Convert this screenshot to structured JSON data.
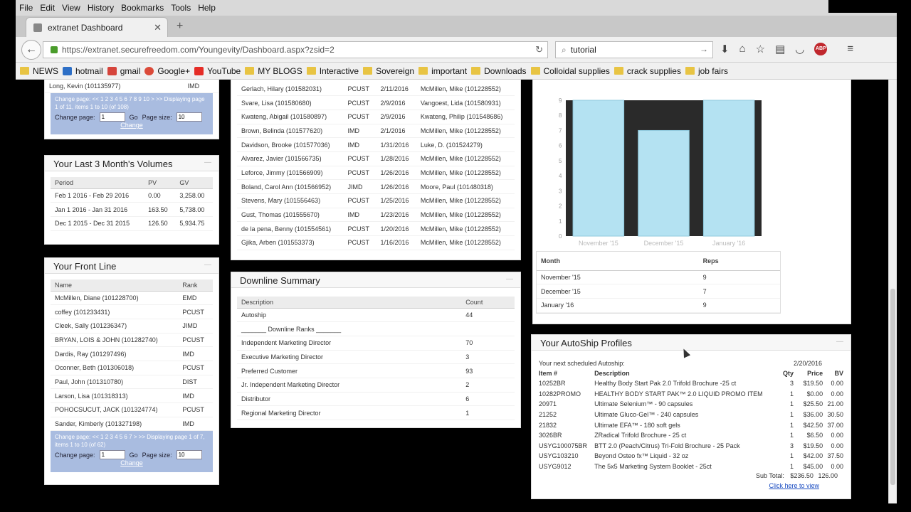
{
  "menubar": [
    "File",
    "Edit",
    "View",
    "History",
    "Bookmarks",
    "Tools",
    "Help"
  ],
  "tab": {
    "title": "extranet Dashboard"
  },
  "nav": {
    "url": "https://extranet.securefreedom.com/Youngevity/Dashboard.aspx?zsid=2",
    "search_value": "tutorial"
  },
  "bookmarks": [
    "NEWS",
    "hotmail",
    "gmail",
    "Google+",
    "YouTube",
    "MY BLOGS",
    "Interactive",
    "Sovereign",
    "important",
    "Downloads",
    "Colloidal supplies",
    "crack supplies",
    "job fairs"
  ],
  "colors": {
    "pager_bg": "#a9bce0",
    "bar_fill": "#b4e2f2",
    "link": "#1a4cc2",
    "folder": "#e8c443"
  },
  "topleft": {
    "row_name": "Long, Kevin (101135977)",
    "row_rank": "IMD",
    "pager_text": "Change page: << 1 2 3 4 5 6 7 8 9 10 > >> Displaying page 1 of 11, items 1 to 10 (of 108)",
    "change_page_label": "Change page:",
    "change_page_value": "1",
    "go": "Go",
    "page_size_label": "Page size:",
    "page_size_value": "10",
    "change": "Change"
  },
  "volumes": {
    "title": "Your Last 3 Month's Volumes",
    "headers": [
      "Period",
      "PV",
      "GV"
    ],
    "rows": [
      [
        "Feb 1 2016 - Feb 29 2016",
        "0.00",
        "3,258.00"
      ],
      [
        "Jan 1 2016 - Jan 31 2016",
        "163.50",
        "5,738.00"
      ],
      [
        "Dec 1 2015 - Dec 31 2015",
        "126.50",
        "5,934.75"
      ]
    ]
  },
  "frontline": {
    "title": "Your Front Line",
    "headers": [
      "Name",
      "Rank"
    ],
    "rows": [
      [
        "McMillen, Diane (101228700)",
        "EMD"
      ],
      [
        "coffey (101233431)",
        "PCUST"
      ],
      [
        "Cleek, Sally (101236347)",
        "JIMD"
      ],
      [
        "BRYAN, LOIS & JOHN (101282740)",
        "PCUST"
      ],
      [
        "Dardis, Ray (101297496)",
        "IMD"
      ],
      [
        "Oconner, Beth (101306018)",
        "PCUST"
      ],
      [
        "Paul, John (101310780)",
        "DIST"
      ],
      [
        "Larson, Lisa (101318313)",
        "IMD"
      ],
      [
        "POHOCSUCUT, JACK (101324774)",
        "PCUST"
      ],
      [
        "Sander, Kimberly (101327198)",
        "IMD"
      ]
    ],
    "pager_text": "Change page: << 1 2 3 4 5 6 7 > >> Displaying page 1 of 7, items 1 to 10 (of 62)",
    "change_page_label": "Change page:",
    "change_page_value": "1",
    "go": "Go",
    "page_size_label": "Page size:",
    "page_size_value": "10",
    "change": "Change"
  },
  "recent": {
    "rows": [
      [
        "Gerlach, Hilary (101582031)",
        "PCUST",
        "2/11/2016",
        "McMillen, Mike (101228552)"
      ],
      [
        "Svare, Lisa (101580680)",
        "PCUST",
        "2/9/2016",
        "Vangoest, Lida (101580931)"
      ],
      [
        "Kwateng, Abigail (101580897)",
        "PCUST",
        "2/9/2016",
        "Kwateng, Philip (101548686)"
      ],
      [
        "Brown, Belinda (101577620)",
        "IMD",
        "2/1/2016",
        "McMillen, Mike (101228552)"
      ],
      [
        "Davidson, Brooke (101577036)",
        "IMD",
        "1/31/2016",
        "Luke, D. (101524279)"
      ],
      [
        "Alvarez, Javier (101566735)",
        "PCUST",
        "1/28/2016",
        "McMillen, Mike (101228552)"
      ],
      [
        "Leforce, Jimmy (101566909)",
        "PCUST",
        "1/26/2016",
        "McMillen, Mike (101228552)"
      ],
      [
        "Boland, Carol Ann (101566952)",
        "JIMD",
        "1/26/2016",
        "Moore, Paul (101480318)"
      ],
      [
        "Stevens, Mary (101556463)",
        "PCUST",
        "1/25/2016",
        "McMillen, Mike (101228552)"
      ],
      [
        "Gust, Thomas (101555670)",
        "IMD",
        "1/23/2016",
        "McMillen, Mike (101228552)"
      ],
      [
        "de la pena, Benny (101554561)",
        "PCUST",
        "1/20/2016",
        "McMillen, Mike (101228552)"
      ],
      [
        "Gjika, Arben (101553373)",
        "PCUST",
        "1/16/2016",
        "McMillen, Mike (101228552)"
      ]
    ]
  },
  "downline": {
    "title": "Downline Summary",
    "headers": [
      "Description",
      "Count"
    ],
    "rows": [
      [
        "Autoship",
        "44"
      ],
      [
        "_______ Downline Ranks _______",
        ""
      ],
      [
        "Independent Marketing Director",
        "70"
      ],
      [
        "Executive Marketing Director",
        "3"
      ],
      [
        "Preferred Customer",
        "93"
      ],
      [
        "Jr. Independent Marketing Director",
        "2"
      ],
      [
        "Distributor",
        "6"
      ],
      [
        "Regional Marketing Director",
        "1"
      ]
    ]
  },
  "chart_data": {
    "type": "bar",
    "categories": [
      "November '15",
      "December '15",
      "January '16"
    ],
    "values": [
      9,
      7,
      9
    ],
    "ylim": [
      0,
      9
    ],
    "yticks": [
      "0",
      "1",
      "2",
      "3",
      "4",
      "5",
      "6",
      "7",
      "8",
      "9"
    ],
    "grid": false,
    "table_headers": [
      "Month",
      "Reps"
    ],
    "table_rows": [
      [
        "November '15",
        "9"
      ],
      [
        "December '15",
        "7"
      ],
      [
        "January '16",
        "9"
      ]
    ]
  },
  "autoship": {
    "title": "Your AutoShip Profiles",
    "next_label": "Your next scheduled Autoship:",
    "next_date": "2/20/2016",
    "headers": [
      "Item #",
      "Description",
      "Qty",
      "Price",
      "BV"
    ],
    "rows": [
      [
        "10252BR",
        "Healthy Body Start Pak 2.0 Trifold Brochure -25 ct",
        "3",
        "$19.50",
        "0.00"
      ],
      [
        "10282PROMO",
        "HEALTHY BODY START PAK™ 2.0 LIQUID PROMO ITEM",
        "1",
        "$0.00",
        "0.00"
      ],
      [
        "20971",
        "Ultimate Selenium™ - 90 capsules",
        "1",
        "$25.50",
        "21.00"
      ],
      [
        "21252",
        "Ultimate Gluco-Gel™ - 240 capsules",
        "1",
        "$36.00",
        "30.50"
      ],
      [
        "21832",
        "Ultimate EFA™ - 180 soft gels",
        "1",
        "$42.50",
        "37.00"
      ],
      [
        "3026BR",
        "ZRadical Trifold Brochure - 25 ct",
        "1",
        "$6.50",
        "0.00"
      ],
      [
        "USYG100075BR",
        "BTT 2.0 (Peach/Citrus) Tri-Fold Brochure - 25 Pack",
        "3",
        "$19.50",
        "0.00"
      ],
      [
        "USYG103210",
        "Beyond Osteo fx™ Liquid - 32 oz",
        "1",
        "$42.00",
        "37.50"
      ],
      [
        "USYG9012",
        "The 5x5 Marketing System Booklet - 25ct",
        "1",
        "$45.00",
        "0.00"
      ]
    ],
    "subtotal_label": "Sub Total:",
    "subtotal_price": "$236.50",
    "subtotal_bv": "126.00",
    "view_link": "Click here to view"
  }
}
